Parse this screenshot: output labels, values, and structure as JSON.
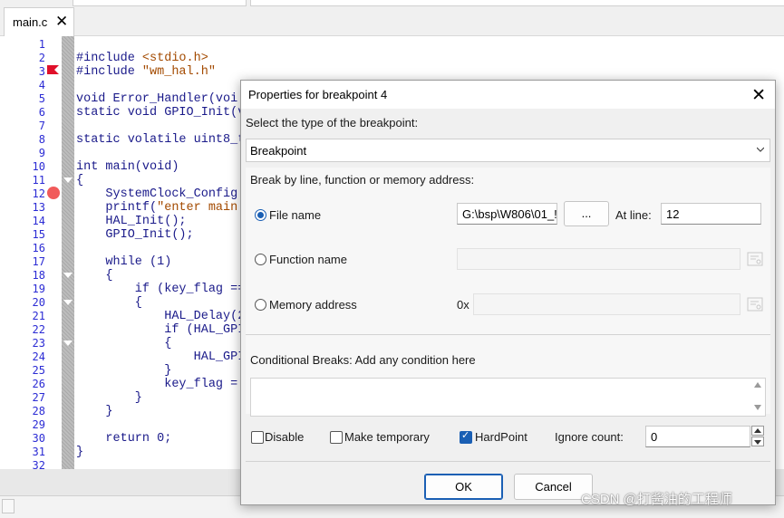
{
  "tab": {
    "filename": "main.c",
    "close_glyph": "✕"
  },
  "editor": {
    "line_numbers": [
      "1",
      "2",
      "3",
      "4",
      "5",
      "6",
      "7",
      "8",
      "9",
      "10",
      "11",
      "12",
      "13",
      "14",
      "15",
      "16",
      "17",
      "18",
      "19",
      "20",
      "21",
      "22",
      "23",
      "24",
      "25",
      "26",
      "27",
      "28",
      "29",
      "30",
      "31",
      "32"
    ],
    "code": [
      {
        "pre": "",
        "str": "",
        "post": ""
      },
      {
        "pre": "#include ",
        "str": "<stdio.h>",
        "post": ""
      },
      {
        "pre": "#include ",
        "str": "\"wm_hal.h\"",
        "post": ""
      },
      {
        "pre": "",
        "str": "",
        "post": ""
      },
      {
        "pre": "void Error_Handler(voi",
        "str": "",
        "post": ""
      },
      {
        "pre": "static void GPIO_Init(v",
        "str": "",
        "post": ""
      },
      {
        "pre": "",
        "str": "",
        "post": ""
      },
      {
        "pre": "static volatile uint8_t",
        "str": "",
        "post": ""
      },
      {
        "pre": "",
        "str": "",
        "post": ""
      },
      {
        "pre": "int main(void)",
        "str": "",
        "post": ""
      },
      {
        "pre": "{",
        "str": "",
        "post": ""
      },
      {
        "pre": "    SystemClock_Config",
        "str": "",
        "post": ""
      },
      {
        "pre": "    printf(",
        "str": "\"enter main",
        "post": ""
      },
      {
        "pre": "    HAL_Init();",
        "str": "",
        "post": ""
      },
      {
        "pre": "    GPIO_Init();",
        "str": "",
        "post": ""
      },
      {
        "pre": "",
        "str": "",
        "post": ""
      },
      {
        "pre": "    while (1)",
        "str": "",
        "post": ""
      },
      {
        "pre": "    {",
        "str": "",
        "post": ""
      },
      {
        "pre": "        if (key_flag ==",
        "str": "",
        "post": ""
      },
      {
        "pre": "        {",
        "str": "",
        "post": ""
      },
      {
        "pre": "            HAL_Delay(2",
        "str": "",
        "post": ""
      },
      {
        "pre": "            if (HAL_GPI",
        "str": "",
        "post": ""
      },
      {
        "pre": "            {",
        "str": "",
        "post": ""
      },
      {
        "pre": "                HAL_GPI",
        "str": "",
        "post": ""
      },
      {
        "pre": "            }",
        "str": "",
        "post": ""
      },
      {
        "pre": "            key_flag =",
        "str": "",
        "post": ""
      },
      {
        "pre": "        }",
        "str": "",
        "post": ""
      },
      {
        "pre": "    }",
        "str": "",
        "post": ""
      },
      {
        "pre": "",
        "str": "",
        "post": ""
      },
      {
        "pre": "    return 0;",
        "str": "",
        "post": ""
      },
      {
        "pre": "}",
        "str": "",
        "post": ""
      },
      {
        "pre": "",
        "str": "",
        "post": ""
      }
    ],
    "colors": {
      "keyword": "#1a1a8a",
      "string": "#a34a00",
      "line_number": "#2b2bd4",
      "breakpoint": "#f15a5a",
      "bookmark": "#e0102a"
    }
  },
  "dialog": {
    "title": "Properties for breakpoint 4",
    "close_glyph": "✕",
    "type_label": "Select the type of the breakpoint:",
    "type_value": "Breakpoint",
    "break_by_label": "Break by line, function or memory address:",
    "file_name": {
      "label": "File name",
      "value": "G:\\bsp\\W806\\01_!",
      "browse_label": "...",
      "at_line_label": "At line:",
      "line_value": "12"
    },
    "function_name": {
      "label": "Function name",
      "value": ""
    },
    "memory_address": {
      "label": "Memory address",
      "prefix": "0x",
      "value": ""
    },
    "conditional_label": "Conditional Breaks: Add any condition here",
    "condition_value": "",
    "disable_label": "Disable",
    "temporary_label": "Make temporary",
    "hardpoint_label": "HardPoint",
    "ignore_label": "Ignore count:",
    "ignore_value": "0",
    "ok_label": "OK",
    "cancel_label": "Cancel",
    "accent_color": "#1a5fb4"
  },
  "watermark": "CSDN @打酱油的工程师"
}
